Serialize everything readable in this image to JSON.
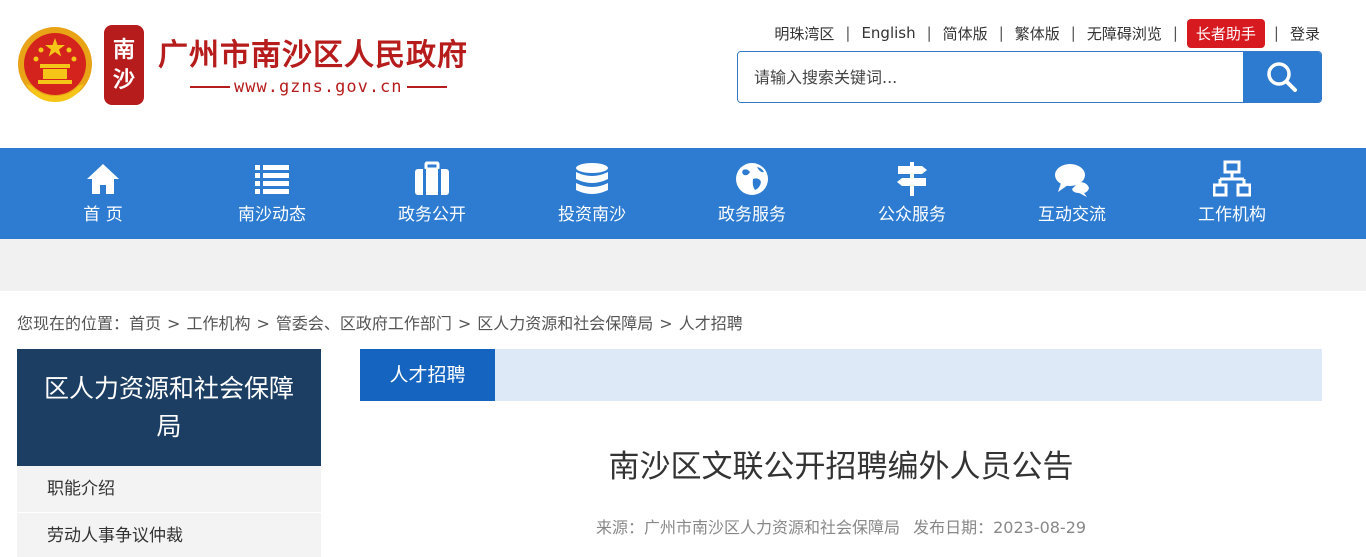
{
  "header": {
    "seal_chars": [
      "南",
      "沙"
    ],
    "site_title": "广州市南沙区人民政府",
    "site_url": "www.gzns.gov.cn"
  },
  "toplinks": {
    "greater_bay": "明珠湾区",
    "english": "English",
    "simplified": "简体版",
    "traditional": "繁体版",
    "accessible": "无障碍浏览",
    "elder": "长者助手",
    "login": "登录"
  },
  "search": {
    "placeholder": "请输入搜索关键词..."
  },
  "nav": {
    "items": [
      {
        "label": "首 页",
        "icon": "home-icon"
      },
      {
        "label": "南沙动态",
        "icon": "list-icon"
      },
      {
        "label": "政务公开",
        "icon": "briefcase-icon"
      },
      {
        "label": "投资南沙",
        "icon": "database-icon"
      },
      {
        "label": "政务服务",
        "icon": "globe-icon"
      },
      {
        "label": "公众服务",
        "icon": "signpost-icon"
      },
      {
        "label": "互动交流",
        "icon": "chat-icon"
      },
      {
        "label": "工作机构",
        "icon": "org-chart-icon"
      }
    ]
  },
  "breadcrumb": {
    "prefix": "您现在的位置：",
    "items": [
      "首页",
      "工作机构",
      "管委会、区政府工作部门",
      "区人力资源和社会保障局",
      "人才招聘"
    ],
    "separator": ">"
  },
  "sidebar": {
    "title": "区人力资源和社会保障局",
    "items": [
      "职能介绍",
      "劳动人事争议仲裁"
    ]
  },
  "content": {
    "tab": "人才招聘",
    "article_title": "南沙区文联公开招聘编外人员公告",
    "source_label": "来源：",
    "source": "广州市南沙区人力资源和社会保障局",
    "date_label": "发布日期：",
    "date": "2023-08-29"
  },
  "colors": {
    "brand_red": "#b71c1c",
    "nav_blue": "#2e7cd1",
    "sidebar_navy": "#1c3e63",
    "tab_blue": "#1565c0",
    "elder_red": "#d71920"
  }
}
